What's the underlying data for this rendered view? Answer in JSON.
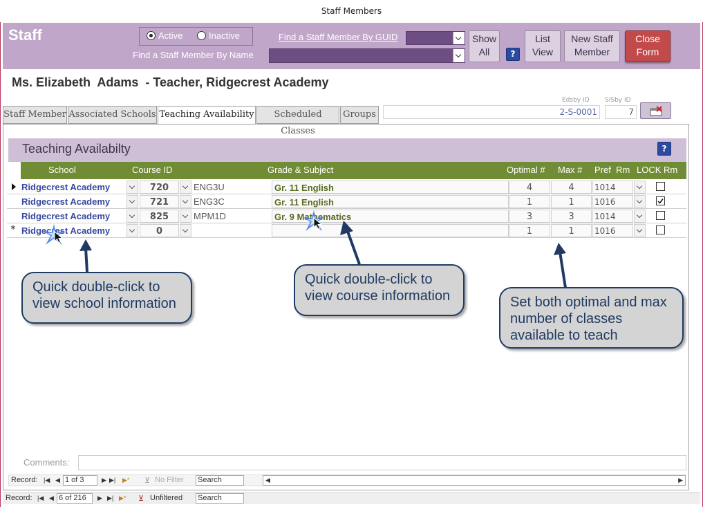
{
  "window": {
    "title": "Staff Members"
  },
  "header": {
    "form_title": "Staff",
    "status_options": [
      {
        "label": "Active",
        "selected": true
      },
      {
        "label": "Inactive",
        "selected": false
      }
    ],
    "find_by_guid_label": "Find a Staff Member By GUID",
    "find_by_name_label": "Find a Staff Member By Name",
    "show_all_label": [
      "Show",
      "All"
    ],
    "help_label": "?",
    "list_view_label": [
      "List",
      "View"
    ],
    "new_staff_label": [
      "New Staff",
      "Member"
    ],
    "close_form_label": [
      "Close",
      "Form"
    ]
  },
  "record": {
    "name_line": "Ms. Elizabeth  Adams  - Teacher, Ridgecrest Academy",
    "edsby_label": "Edsby ID",
    "edsby_value": "2-S-0001",
    "sisby_label": "SISby ID",
    "sisby_value": "7"
  },
  "tabs": [
    {
      "label": "Staff Member",
      "active": false
    },
    {
      "label": "Associated Schools",
      "active": false
    },
    {
      "label": "Teaching Availability",
      "active": true
    },
    {
      "label": "Scheduled Classes",
      "active": false
    },
    {
      "label": "Groups",
      "active": false
    }
  ],
  "section": {
    "title": "Teaching Availabilty",
    "help_label": "?"
  },
  "grid": {
    "columns": [
      "School",
      "Course ID",
      "Grade & Subject",
      "Optimal #",
      "Max #",
      "Pref  Rm",
      "LOCK Rm"
    ],
    "rows": [
      {
        "selector": "current",
        "school": "Ridgecrest Academy",
        "course_id": "720",
        "code": "ENG3U",
        "subject": "Gr. 11 English",
        "optimal": "4",
        "max": "4",
        "room": "1014",
        "lock": false
      },
      {
        "selector": "",
        "school": "Ridgecrest Academy",
        "course_id": "721",
        "code": "ENG3C",
        "subject": "Gr. 11 English",
        "optimal": "1",
        "max": "1",
        "room": "1016",
        "lock": true
      },
      {
        "selector": "",
        "school": "Ridgecrest Academy",
        "course_id": "825",
        "code": "MPM1D",
        "subject": "Gr. 9 Mathematics",
        "optimal": "3",
        "max": "3",
        "room": "1014",
        "lock": false
      },
      {
        "selector": "new",
        "school": "Ridgecrest Academy",
        "course_id": "0",
        "code": "",
        "subject": "",
        "optimal": "1",
        "max": "1",
        "room": "1016",
        "lock": false
      }
    ],
    "new_record_marker": "*"
  },
  "callouts": {
    "school": "Quick double-click to view school information",
    "course": "Quick double-click to view course information",
    "optimal": "Set both optimal and max number of classes available to teach"
  },
  "footer": {
    "comments_label": "Comments:",
    "subform_nav": {
      "record_label": "Record:",
      "position": "1 of 3",
      "filter": "No Filter",
      "search": "Search"
    },
    "main_nav": {
      "record_label": "Record:",
      "position": "6 of 216",
      "filter": "Unfiltered",
      "search": "Search"
    }
  },
  "colors": {
    "header_band": "#c0a6c8",
    "grid_header": "#708c34",
    "school_text": "#3848a0",
    "subject_text": "#5a6b21",
    "close_button": "#c34a4a",
    "callout_border": "#1f3a63"
  }
}
